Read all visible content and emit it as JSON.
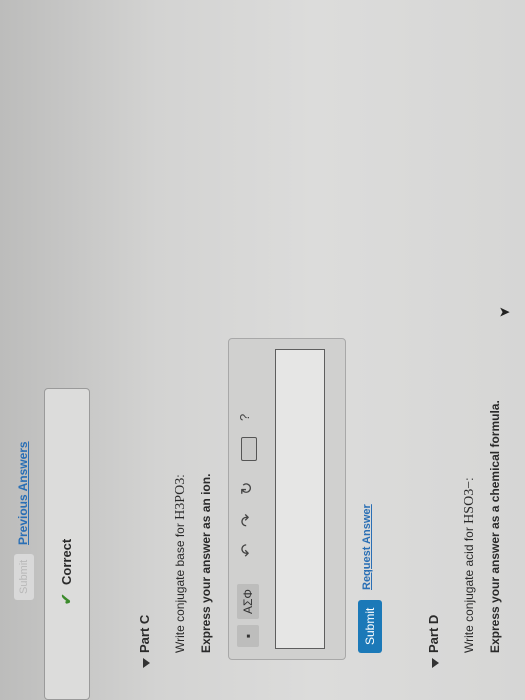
{
  "previous": {
    "submit_label": "Submit",
    "previous_answers": "Previous Answers"
  },
  "feedback": {
    "correct": "Correct"
  },
  "part_c": {
    "title": "Part C",
    "prompt_prefix": "Write conjugate base for ",
    "formula": "H3PO3",
    "prompt_suffix": ":",
    "instruction": "Express your answer as an ion.",
    "toolbar": {
      "greek_label": "ΑΣΦ",
      "help_label": "?"
    },
    "input_value": "",
    "submit_label": "Submit",
    "request_answer": "Request Answer"
  },
  "part_d": {
    "title": "Part D",
    "prompt_prefix": "Write conjugate acid for ",
    "formula": "HSO3−",
    "prompt_suffix": ":",
    "instruction": "Express your answer as a chemical formula."
  },
  "colors": {
    "link": "#2a6fb5",
    "submit": "#1b79b8",
    "check": "#3a8a2a"
  }
}
